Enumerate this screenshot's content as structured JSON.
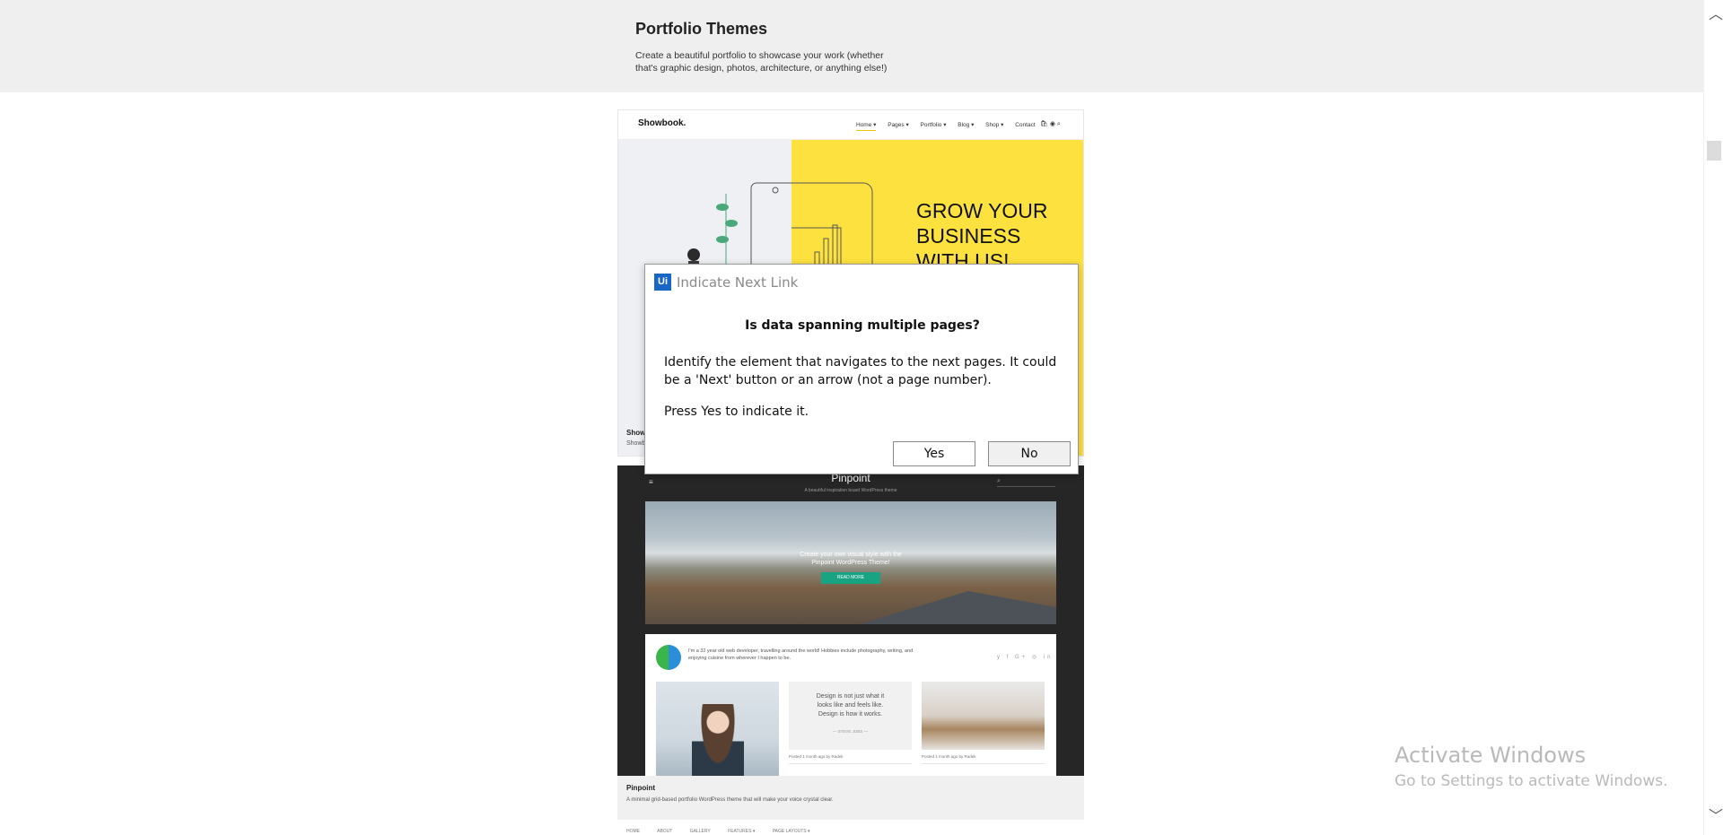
{
  "header": {
    "title": "Portfolio Themes",
    "description": "Create a beautiful portfolio to showcase your work (whether that's graphic design, photos, architecture, or anything else!)"
  },
  "showbook": {
    "logo": "Showbook.",
    "nav": [
      "Home ▾",
      "Pages ▾",
      "Portfolio ▾",
      "Blog ▾",
      "Shop ▾",
      "Contact"
    ],
    "icons": "🛍 ◉ ⌕",
    "headline_1": "GROW YOUR",
    "headline_2": "BUSINESS",
    "headline_3": "WITH US!",
    "caption_title": "Show",
    "caption_sub": "Showb"
  },
  "pinpoint": {
    "menu_icon": "≡",
    "title": "Pinpoint",
    "tagline": "A beautiful inspiration board WordPress theme",
    "search_icon": "⌕",
    "hero_text_1": "Create your own visual style with the",
    "hero_text_2": "Pinpoint WordPress Theme!",
    "hero_button": "READ MORE",
    "bio": "I'm a 32 year old web developer, travelling around the world! Hobbies include photography, writing, and enjoying cuisine from wherever I happen to be.",
    "social": "y f G+ ◎ in",
    "quote_1": "Design is not just what it",
    "quote_2": "looks like and feels like.",
    "quote_3": "Design is how it works.",
    "quote_by": "— STEVE JOBS —",
    "meta_2": "Posted 1 month ago by Radek",
    "meta_3": "Posted 1 month ago by Radek",
    "caption_title": "Pinpoint",
    "caption_sub": "A minimal grid-based portfolio WordPress theme that will make your voice crystal clear."
  },
  "bottom_nav": [
    "HOME",
    "ABOUT",
    "GALLERY",
    "FEATURES ▾",
    "PAGE LAYOUTS ▾"
  ],
  "dialog": {
    "logo": "Ui",
    "title": "Indicate Next Link",
    "question": "Is data spanning multiple pages?",
    "body": "Identify the element that navigates to the next pages. It could be a 'Next' button or an arrow (not a page number).",
    "press": "Press Yes to indicate it.",
    "yes_label": "Yes",
    "no_label": "No"
  },
  "scrollbar": {
    "up_icon": "︿",
    "down_icon": "﹀"
  },
  "watermark": {
    "title": "Activate Windows",
    "subtitle": "Go to Settings to activate Windows."
  }
}
